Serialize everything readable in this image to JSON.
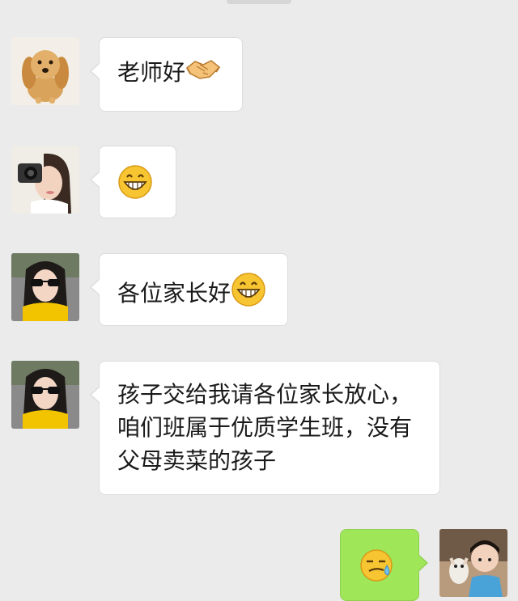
{
  "messages": [
    {
      "sender": "dog-avatar",
      "side": "left",
      "text": "老师好",
      "emoji": "handshake-emoji"
    },
    {
      "sender": "camera-girl-avatar",
      "side": "left",
      "text": "",
      "emoji": "grin-emoji"
    },
    {
      "sender": "sunglasses-girl-avatar",
      "side": "left",
      "text": "各位家长好",
      "emoji": "grin-emoji"
    },
    {
      "sender": "sunglasses-girl-avatar",
      "side": "left",
      "lines": [
        "孩子交给我请各位家长放心，",
        "咱们班属于优质学生班，没有",
        "父母卖菜的孩子"
      ]
    },
    {
      "sender": "boy-with-dog-avatar",
      "side": "right",
      "text": "",
      "emoji": "sweat-smirk-emoji"
    }
  ],
  "colors": {
    "background": "#ebebeb",
    "bubble_incoming": "#ffffff",
    "bubble_outgoing": "#9fe659"
  }
}
